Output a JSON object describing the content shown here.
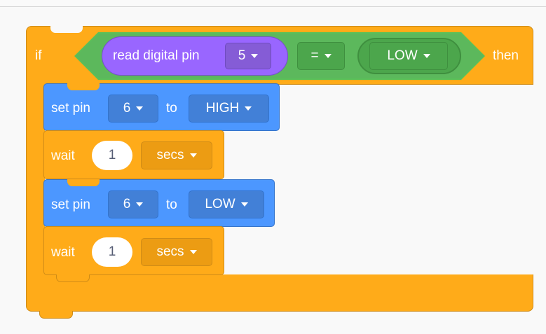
{
  "if_block": {
    "if_label": "if",
    "then_label": "then"
  },
  "condition": {
    "reporter_label": "read digital pin",
    "pin_value": "5",
    "operator": "=",
    "compare_value": "LOW"
  },
  "blocks": [
    {
      "type": "set_pin",
      "label": "set pin",
      "pin": "6",
      "to_label": "to",
      "value": "HIGH"
    },
    {
      "type": "wait",
      "label": "wait",
      "amount": "1",
      "unit": "secs"
    },
    {
      "type": "set_pin",
      "label": "set pin",
      "pin": "6",
      "to_label": "to",
      "value": "LOW"
    },
    {
      "type": "wait",
      "label": "wait",
      "amount": "1",
      "unit": "secs"
    }
  ],
  "colors": {
    "control": "#ffab19",
    "pins": "#4c97ff",
    "operator": "#59c059",
    "sensor": "#9966ff"
  }
}
